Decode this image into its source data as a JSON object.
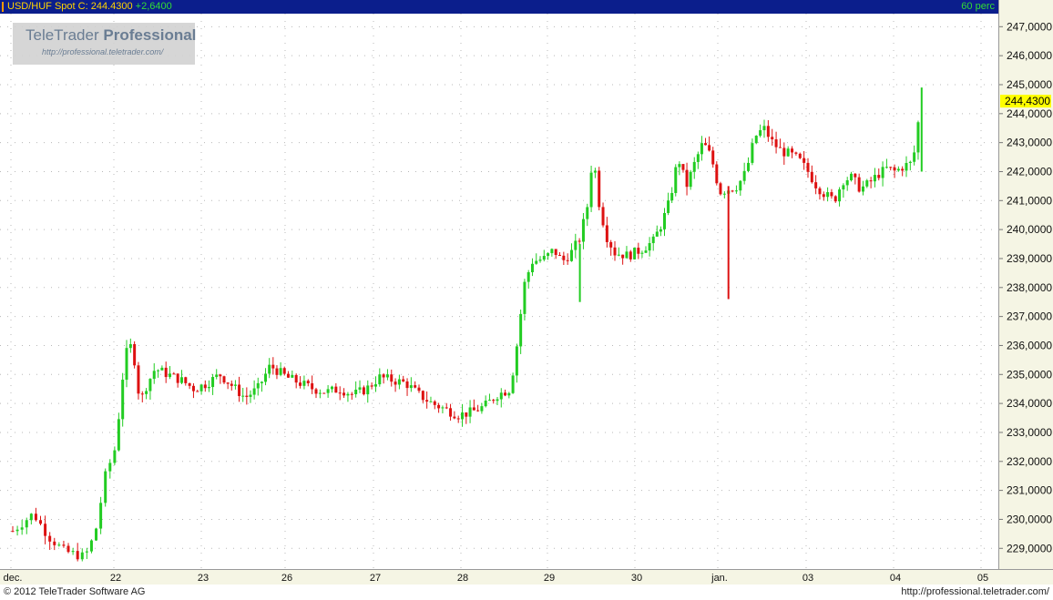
{
  "header": {
    "symbol": "USD/HUF Spot",
    "close_label": "C:",
    "close_value": "244.4300",
    "change": "+2,6400",
    "interval": "60 perc"
  },
  "watermark": {
    "brand_light": "TeleTrader",
    "brand_bold": "Professional",
    "url": "http://professional.teletrader.com/"
  },
  "footer": {
    "copyright": "© 2012 TeleTrader Software AG",
    "url": "http://professional.teletrader.com/"
  },
  "colors": {
    "up": "#22cc22",
    "down": "#dd1111",
    "grid": "#b8b8b8",
    "last_price_bg": "#ffff00"
  },
  "chart_data": {
    "type": "candlestick",
    "ylim": [
      228.6,
      247.45
    ],
    "y_ticks": [
      "247,0000",
      "246,0000",
      "245,0000",
      "244,0000",
      "243,0000",
      "242,0000",
      "241,0000",
      "240,0000",
      "239,0000",
      "238,0000",
      "237,0000",
      "236,0000",
      "235,0000",
      "234,0000",
      "233,0000",
      "232,0000",
      "231,0000",
      "230,0000",
      "229,0000"
    ],
    "y_tick_values": [
      247,
      246,
      245,
      244,
      243,
      242,
      241,
      240,
      239,
      238,
      237,
      236,
      235,
      234,
      233,
      232,
      231,
      230,
      229
    ],
    "last_price_label": "244,4300",
    "last_price": 244.43,
    "x_labels": [
      "dec.",
      "22",
      "23",
      "26",
      "27",
      "28",
      "29",
      "30",
      "jan.",
      "03",
      "04",
      "05"
    ],
    "x_label_index": [
      0,
      1,
      2,
      3,
      4,
      5,
      6,
      7,
      8,
      9,
      10,
      11
    ],
    "close_path": [
      [
        0,
        229.6
      ],
      [
        0.2,
        230.2
      ],
      [
        0.35,
        229.4
      ],
      [
        0.5,
        228.9
      ],
      [
        0.7,
        228.7
      ],
      [
        0.8,
        229.5
      ],
      [
        0.9,
        231.5
      ],
      [
        1.0,
        232.5
      ],
      [
        1.05,
        234.0
      ],
      [
        1.1,
        235.5
      ],
      [
        1.15,
        236.0
      ],
      [
        1.2,
        235.9
      ],
      [
        1.25,
        234.5
      ],
      [
        1.3,
        234.2
      ],
      [
        1.35,
        234.6
      ],
      [
        1.45,
        235.2
      ],
      [
        1.6,
        235.0
      ],
      [
        1.75,
        234.8
      ],
      [
        1.9,
        234.5
      ],
      [
        2.05,
        234.7
      ],
      [
        2.2,
        235.0
      ],
      [
        2.35,
        234.6
      ],
      [
        2.5,
        234.2
      ],
      [
        2.65,
        234.5
      ],
      [
        2.8,
        235.3
      ],
      [
        3.0,
        234.9
      ],
      [
        3.15,
        234.7
      ],
      [
        3.3,
        234.5
      ],
      [
        3.45,
        234.4
      ],
      [
        3.6,
        234.5
      ],
      [
        3.75,
        234.3
      ],
      [
        3.9,
        234.5
      ],
      [
        4.05,
        234.9
      ],
      [
        4.2,
        234.8
      ],
      [
        4.35,
        234.7
      ],
      [
        4.5,
        234.3
      ],
      [
        4.65,
        234.0
      ],
      [
        4.8,
        233.8
      ],
      [
        4.95,
        233.6
      ],
      [
        5.1,
        233.7
      ],
      [
        5.25,
        233.9
      ],
      [
        5.4,
        234.3
      ],
      [
        5.55,
        234.5
      ],
      [
        5.65,
        236.5
      ],
      [
        5.7,
        238.0
      ],
      [
        5.8,
        238.9
      ],
      [
        5.95,
        239.0
      ],
      [
        6.05,
        239.3
      ],
      [
        6.15,
        238.9
      ],
      [
        6.25,
        239.2
      ],
      [
        6.35,
        239.7
      ],
      [
        6.45,
        241.0
      ],
      [
        6.5,
        242.8
      ],
      [
        6.55,
        241.2
      ],
      [
        6.65,
        239.8
      ],
      [
        6.75,
        239.2
      ],
      [
        6.9,
        239.1
      ],
      [
        7.05,
        239.3
      ],
      [
        7.2,
        239.6
      ],
      [
        7.3,
        240.2
      ],
      [
        7.4,
        241.0
      ],
      [
        7.5,
        242.5
      ],
      [
        7.6,
        241.5
      ],
      [
        7.7,
        242.3
      ],
      [
        7.8,
        243.0
      ],
      [
        7.9,
        242.5
      ],
      [
        8.0,
        241.3
      ],
      [
        8.1,
        241.4
      ],
      [
        8.2,
        241.5
      ],
      [
        8.3,
        242.0
      ],
      [
        8.4,
        243.2
      ],
      [
        8.5,
        243.5
      ],
      [
        8.6,
        243.0
      ],
      [
        8.7,
        242.7
      ],
      [
        8.8,
        242.6
      ],
      [
        8.9,
        242.4
      ],
      [
        9.0,
        242.0
      ],
      [
        9.1,
        241.5
      ],
      [
        9.2,
        241.2
      ],
      [
        9.3,
        241.0
      ],
      [
        9.4,
        241.7
      ],
      [
        9.5,
        241.8
      ],
      [
        9.6,
        241.4
      ],
      [
        9.7,
        241.6
      ],
      [
        9.8,
        241.9
      ],
      [
        9.9,
        242.1
      ],
      [
        10.0,
        242.0
      ],
      [
        10.1,
        242.2
      ],
      [
        10.2,
        242.3
      ],
      [
        10.25,
        243.5
      ],
      [
        10.3,
        244.4
      ]
    ]
  }
}
